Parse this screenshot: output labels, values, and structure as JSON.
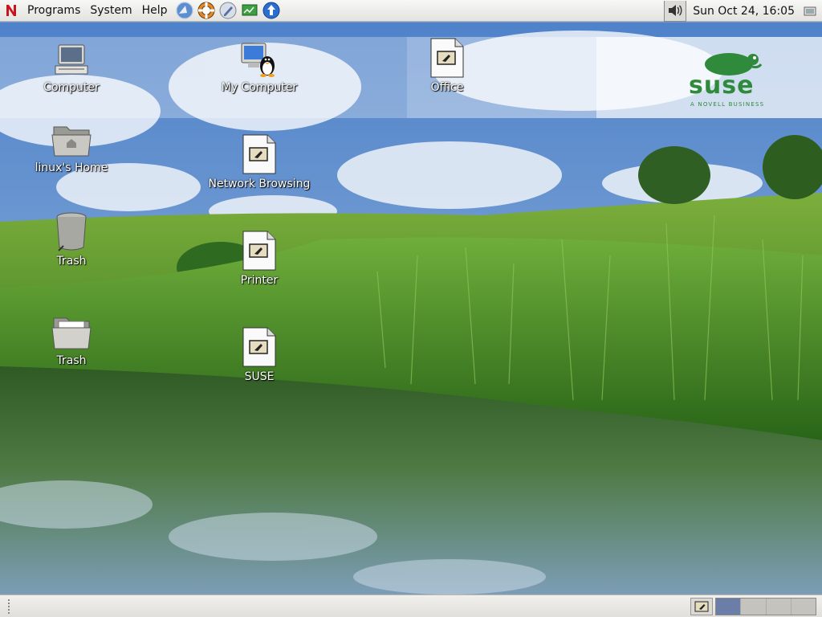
{
  "top_panel": {
    "menus": [
      "Programs",
      "System",
      "Help"
    ],
    "launchers": [
      "web-browser-icon",
      "help-lifebuoy-icon",
      "text-editor-icon",
      "network-monitor-icon",
      "software-update-icon"
    ],
    "clock": "Sun Oct 24, 16:05"
  },
  "desktop": {
    "icons": [
      {
        "label": "Computer",
        "icon": "computer-icon"
      },
      {
        "label": "My Computer",
        "icon": "tux-computer-icon"
      },
      {
        "label": "Office",
        "icon": "launcher-document-icon"
      },
      {
        "label": "linux's Home",
        "icon": "home-folder-icon"
      },
      {
        "label": "Network Browsing",
        "icon": "launcher-document-icon"
      },
      {
        "label": "Trash",
        "icon": "trash-can-icon"
      },
      {
        "label": "Printer",
        "icon": "launcher-document-icon"
      },
      {
        "label": "Trash",
        "icon": "folder-documents-icon"
      },
      {
        "label": "SUSE",
        "icon": "launcher-document-icon"
      }
    ],
    "brand": {
      "name": "suse",
      "tagline": "A NOVELL BUSINESS",
      "color": "#2f8a3b"
    }
  },
  "bottom_panel": {
    "workspace_count": 4,
    "active_workspace": 1
  },
  "colors": {
    "sky_top": "#4f82c9",
    "grass": "#5b9a2f",
    "water": "#3f6a3a",
    "label_text": "#ffffff"
  }
}
